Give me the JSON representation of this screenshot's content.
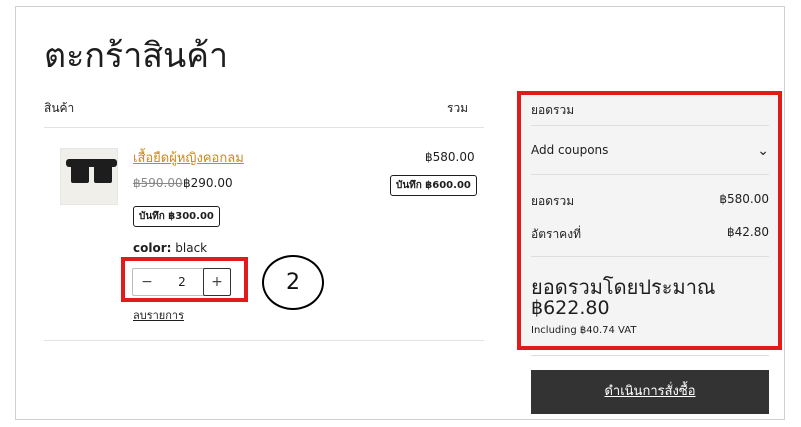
{
  "page": {
    "title": "ตะกร้าสินค้า"
  },
  "cart_table": {
    "col_product": "สินค้า",
    "col_total": "รวม"
  },
  "item": {
    "name": "เสื้อยืดผู้หญิงคอกลม",
    "old_price": "฿590.00",
    "price": "฿290.00",
    "savings_badge": "บันทึก ฿300.00",
    "line_total": "฿580.00",
    "line_savings_badge": "บันทึก ฿600.00",
    "color_label": "color:",
    "color_value": "black",
    "quantity": "2",
    "qty_minus": "−",
    "qty_plus": "+",
    "remove_label": "ลบรายการ"
  },
  "annotation": {
    "number": "2"
  },
  "summary": {
    "heading": "ยอดรวม",
    "coupons_label": "Add coupons",
    "subtotal_label": "ยอดรวม",
    "subtotal_value": "฿580.00",
    "shipping_label": "อัตราคงที่",
    "shipping_value": "฿42.80",
    "estimated_total_label": "ยอดรวมโดยประมาณ",
    "estimated_total_value": "฿622.80",
    "vat_note": "Including ฿40.74 VAT",
    "checkout_label": "ดำเนินการสั่งซื้อ"
  },
  "colors": {
    "accent_link": "#c98a1b",
    "highlight_box": "#e01b1b",
    "checkout_bg": "#333333"
  },
  "icons": {
    "coupon_toggle": "chevron-down-icon"
  }
}
